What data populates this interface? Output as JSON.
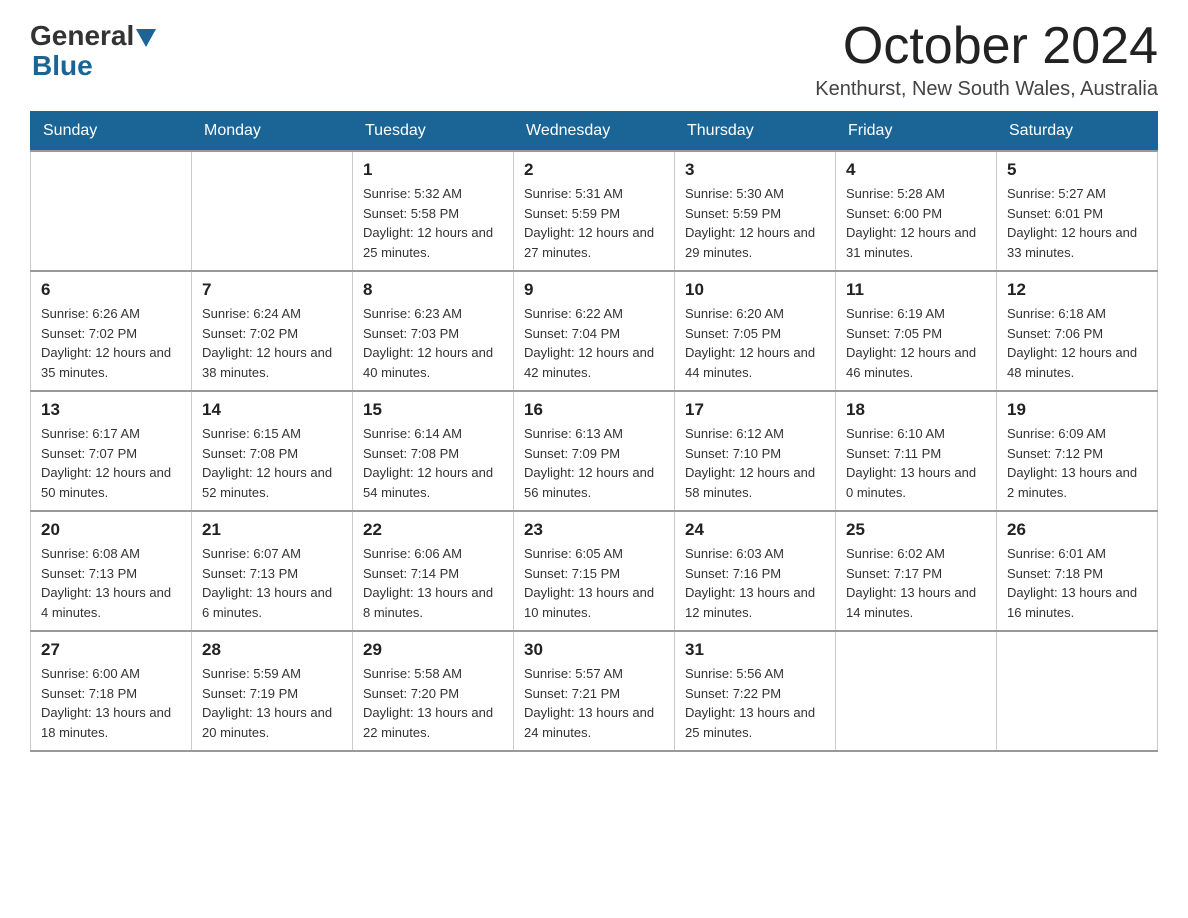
{
  "header": {
    "logo_general": "General",
    "logo_blue": "Blue",
    "month_title": "October 2024",
    "location": "Kenthurst, New South Wales, Australia"
  },
  "weekdays": [
    "Sunday",
    "Monday",
    "Tuesday",
    "Wednesday",
    "Thursday",
    "Friday",
    "Saturday"
  ],
  "weeks": [
    [
      {
        "day": "",
        "info": ""
      },
      {
        "day": "",
        "info": ""
      },
      {
        "day": "1",
        "info": "Sunrise: 5:32 AM\nSunset: 5:58 PM\nDaylight: 12 hours\nand 25 minutes."
      },
      {
        "day": "2",
        "info": "Sunrise: 5:31 AM\nSunset: 5:59 PM\nDaylight: 12 hours\nand 27 minutes."
      },
      {
        "day": "3",
        "info": "Sunrise: 5:30 AM\nSunset: 5:59 PM\nDaylight: 12 hours\nand 29 minutes."
      },
      {
        "day": "4",
        "info": "Sunrise: 5:28 AM\nSunset: 6:00 PM\nDaylight: 12 hours\nand 31 minutes."
      },
      {
        "day": "5",
        "info": "Sunrise: 5:27 AM\nSunset: 6:01 PM\nDaylight: 12 hours\nand 33 minutes."
      }
    ],
    [
      {
        "day": "6",
        "info": "Sunrise: 6:26 AM\nSunset: 7:02 PM\nDaylight: 12 hours\nand 35 minutes."
      },
      {
        "day": "7",
        "info": "Sunrise: 6:24 AM\nSunset: 7:02 PM\nDaylight: 12 hours\nand 38 minutes."
      },
      {
        "day": "8",
        "info": "Sunrise: 6:23 AM\nSunset: 7:03 PM\nDaylight: 12 hours\nand 40 minutes."
      },
      {
        "day": "9",
        "info": "Sunrise: 6:22 AM\nSunset: 7:04 PM\nDaylight: 12 hours\nand 42 minutes."
      },
      {
        "day": "10",
        "info": "Sunrise: 6:20 AM\nSunset: 7:05 PM\nDaylight: 12 hours\nand 44 minutes."
      },
      {
        "day": "11",
        "info": "Sunrise: 6:19 AM\nSunset: 7:05 PM\nDaylight: 12 hours\nand 46 minutes."
      },
      {
        "day": "12",
        "info": "Sunrise: 6:18 AM\nSunset: 7:06 PM\nDaylight: 12 hours\nand 48 minutes."
      }
    ],
    [
      {
        "day": "13",
        "info": "Sunrise: 6:17 AM\nSunset: 7:07 PM\nDaylight: 12 hours\nand 50 minutes."
      },
      {
        "day": "14",
        "info": "Sunrise: 6:15 AM\nSunset: 7:08 PM\nDaylight: 12 hours\nand 52 minutes."
      },
      {
        "day": "15",
        "info": "Sunrise: 6:14 AM\nSunset: 7:08 PM\nDaylight: 12 hours\nand 54 minutes."
      },
      {
        "day": "16",
        "info": "Sunrise: 6:13 AM\nSunset: 7:09 PM\nDaylight: 12 hours\nand 56 minutes."
      },
      {
        "day": "17",
        "info": "Sunrise: 6:12 AM\nSunset: 7:10 PM\nDaylight: 12 hours\nand 58 minutes."
      },
      {
        "day": "18",
        "info": "Sunrise: 6:10 AM\nSunset: 7:11 PM\nDaylight: 13 hours\nand 0 minutes."
      },
      {
        "day": "19",
        "info": "Sunrise: 6:09 AM\nSunset: 7:12 PM\nDaylight: 13 hours\nand 2 minutes."
      }
    ],
    [
      {
        "day": "20",
        "info": "Sunrise: 6:08 AM\nSunset: 7:13 PM\nDaylight: 13 hours\nand 4 minutes."
      },
      {
        "day": "21",
        "info": "Sunrise: 6:07 AM\nSunset: 7:13 PM\nDaylight: 13 hours\nand 6 minutes."
      },
      {
        "day": "22",
        "info": "Sunrise: 6:06 AM\nSunset: 7:14 PM\nDaylight: 13 hours\nand 8 minutes."
      },
      {
        "day": "23",
        "info": "Sunrise: 6:05 AM\nSunset: 7:15 PM\nDaylight: 13 hours\nand 10 minutes."
      },
      {
        "day": "24",
        "info": "Sunrise: 6:03 AM\nSunset: 7:16 PM\nDaylight: 13 hours\nand 12 minutes."
      },
      {
        "day": "25",
        "info": "Sunrise: 6:02 AM\nSunset: 7:17 PM\nDaylight: 13 hours\nand 14 minutes."
      },
      {
        "day": "26",
        "info": "Sunrise: 6:01 AM\nSunset: 7:18 PM\nDaylight: 13 hours\nand 16 minutes."
      }
    ],
    [
      {
        "day": "27",
        "info": "Sunrise: 6:00 AM\nSunset: 7:18 PM\nDaylight: 13 hours\nand 18 minutes."
      },
      {
        "day": "28",
        "info": "Sunrise: 5:59 AM\nSunset: 7:19 PM\nDaylight: 13 hours\nand 20 minutes."
      },
      {
        "day": "29",
        "info": "Sunrise: 5:58 AM\nSunset: 7:20 PM\nDaylight: 13 hours\nand 22 minutes."
      },
      {
        "day": "30",
        "info": "Sunrise: 5:57 AM\nSunset: 7:21 PM\nDaylight: 13 hours\nand 24 minutes."
      },
      {
        "day": "31",
        "info": "Sunrise: 5:56 AM\nSunset: 7:22 PM\nDaylight: 13 hours\nand 25 minutes."
      },
      {
        "day": "",
        "info": ""
      },
      {
        "day": "",
        "info": ""
      }
    ]
  ]
}
